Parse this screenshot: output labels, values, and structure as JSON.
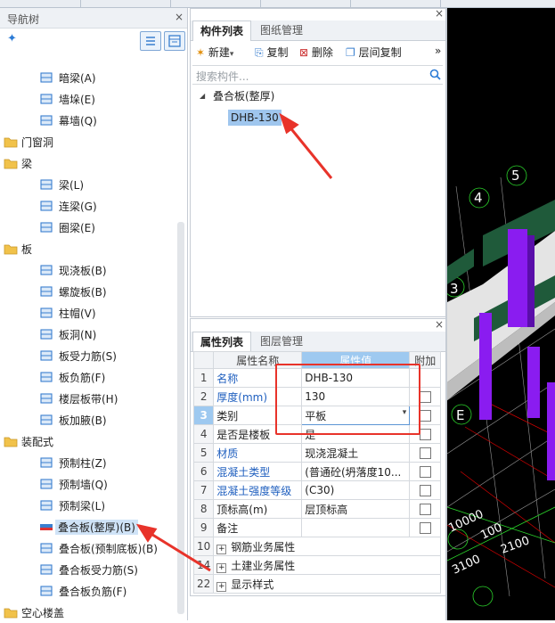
{
  "nav": {
    "title": "导航树",
    "close": "×",
    "items": [
      {
        "label": "暗梁(A)",
        "icon": "hidden-beam-icon",
        "level": 2
      },
      {
        "label": "墙垛(E)",
        "icon": "wall-pier-icon",
        "level": 2
      },
      {
        "label": "幕墙(Q)",
        "icon": "curtain-wall-icon",
        "level": 2
      },
      {
        "label": "门窗洞",
        "icon": "folder-icon",
        "level": 1
      },
      {
        "label": "梁",
        "icon": "folder-icon",
        "level": 1
      },
      {
        "label": "梁(L)",
        "icon": "beam-icon",
        "level": 2
      },
      {
        "label": "连梁(G)",
        "icon": "coupling-beam-icon",
        "level": 2
      },
      {
        "label": "圈梁(E)",
        "icon": "ring-beam-icon",
        "level": 2
      },
      {
        "label": "板",
        "icon": "folder-icon",
        "level": 1
      },
      {
        "label": "现浇板(B)",
        "icon": "cast-slab-icon",
        "level": 2
      },
      {
        "label": "螺旋板(B)",
        "icon": "spiral-slab-icon",
        "level": 2
      },
      {
        "label": "柱帽(V)",
        "icon": "column-cap-icon",
        "level": 2
      },
      {
        "label": "板洞(N)",
        "icon": "slab-hole-icon",
        "level": 2
      },
      {
        "label": "板受力筋(S)",
        "icon": "slab-rebar-icon",
        "level": 2
      },
      {
        "label": "板负筋(F)",
        "icon": "slab-negative-rebar-icon",
        "level": 2
      },
      {
        "label": "楼层板带(H)",
        "icon": "floor-strip-icon",
        "level": 2
      },
      {
        "label": "板加腋(B)",
        "icon": "slab-haunch-icon",
        "level": 2
      },
      {
        "label": "装配式",
        "icon": "folder-icon",
        "level": 1
      },
      {
        "label": "预制柱(Z)",
        "icon": "precast-column-icon",
        "level": 2
      },
      {
        "label": "预制墙(Q)",
        "icon": "precast-wall-icon",
        "level": 2
      },
      {
        "label": "预制梁(L)",
        "icon": "precast-beam-icon",
        "level": 2
      },
      {
        "label": "叠合板(整厚)(B)",
        "icon": "composite-slab-icon",
        "level": 2,
        "selected": true
      },
      {
        "label": "叠合板(预制底板)(B)",
        "icon": "precast-bottom-slab-icon",
        "level": 2
      },
      {
        "label": "叠合板受力筋(S)",
        "icon": "composite-rebar-icon",
        "level": 2
      },
      {
        "label": "叠合板负筋(F)",
        "icon": "composite-negative-rebar-icon",
        "level": 2
      },
      {
        "label": "空心楼盖",
        "icon": "folder-icon",
        "level": 1
      }
    ]
  },
  "comp": {
    "close": "×",
    "tab_active": "构件列表",
    "tab_inactive": "图纸管理",
    "tools": {
      "new": "新建",
      "copy": "复制",
      "delete": "删除",
      "floor_copy": "层间复制",
      "more": "»"
    },
    "search_placeholder": "搜索构件...",
    "group": "叠合板(整厚)",
    "item": "DHB-130"
  },
  "prop": {
    "close": "×",
    "tab_active": "属性列表",
    "tab_inactive": "图层管理",
    "headers": {
      "name": "属性名称",
      "value": "属性值",
      "extra": "附加"
    },
    "rows": [
      {
        "num": "1",
        "name": "名称",
        "value": "DHB-130",
        "blue": true,
        "check": false
      },
      {
        "num": "2",
        "name": "厚度(mm)",
        "value": "130",
        "blue": true,
        "check": true
      },
      {
        "num": "3",
        "name": "类别",
        "value": "平板",
        "blue": false,
        "check": true,
        "dropdown": true
      },
      {
        "num": "4",
        "name": "是否是楼板",
        "value": "是",
        "blue": false,
        "check": true
      },
      {
        "num": "5",
        "name": "材质",
        "value": "现浇混凝土",
        "blue": true,
        "check": true
      },
      {
        "num": "6",
        "name": "混凝土类型",
        "value": "(普通砼(坍落度10...",
        "blue": true,
        "check": true
      },
      {
        "num": "7",
        "name": "混凝土强度等级",
        "value": "(C30)",
        "blue": true,
        "check": true
      },
      {
        "num": "8",
        "name": "顶标高(m)",
        "value": "层顶标高",
        "blue": false,
        "check": true
      },
      {
        "num": "9",
        "name": "备注",
        "value": "",
        "blue": false,
        "check": true
      }
    ],
    "groups": [
      {
        "num": "10",
        "label": "钢筋业务属性"
      },
      {
        "num": "14",
        "label": "土建业务属性"
      },
      {
        "num": "22",
        "label": "显示样式"
      }
    ]
  },
  "view3d": {
    "axis_labels": [
      "5",
      "4",
      "3",
      "E"
    ],
    "dims": [
      "2100",
      "100",
      "3100",
      "10000"
    ],
    "colors": {
      "column": "#8a1cf0",
      "beam": "#1f5a3a",
      "slab": "#e4e4e4"
    }
  },
  "colors": {
    "accent": "#1f5fbf",
    "selection": "#cfe3f7",
    "annotation": "#e8332a"
  }
}
